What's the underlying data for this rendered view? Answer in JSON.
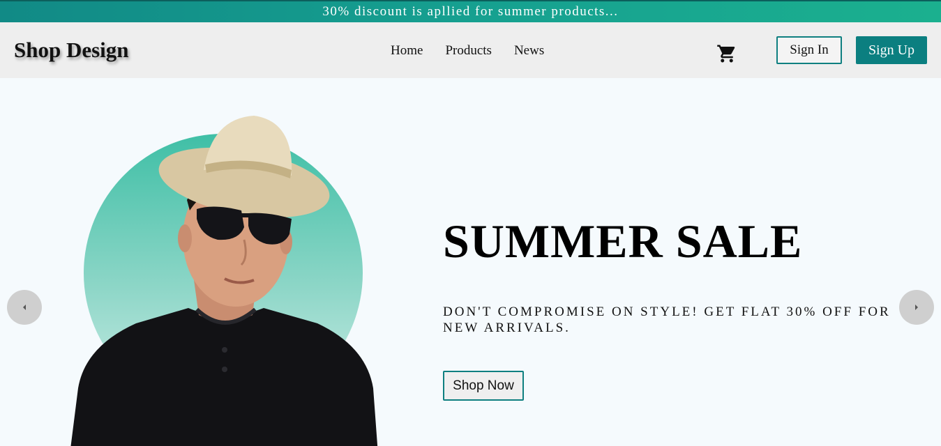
{
  "announcement": {
    "text": "30% discount is apllied for summer products..."
  },
  "header": {
    "logo": "Shop Design",
    "nav": [
      "Home",
      "Products",
      "News"
    ],
    "cart_icon": "shopping-cart-icon",
    "sign_in": "Sign In",
    "sign_up": "Sign Up"
  },
  "hero": {
    "title": "SUMMER SALE",
    "subtitle": "DON'T COMPROMISE ON STYLE! GET FLAT 30% OFF FOR NEW ARRIVALS.",
    "cta": "Shop Now",
    "prev_icon": "arrow-left-icon",
    "next_icon": "arrow-right-icon"
  },
  "colors": {
    "accent": "#0b7f80",
    "announce_bg": "#16a090",
    "nav_bg": "#eeeeee",
    "page_bg": "#f5fafd",
    "circle": "#3fbfa6"
  }
}
